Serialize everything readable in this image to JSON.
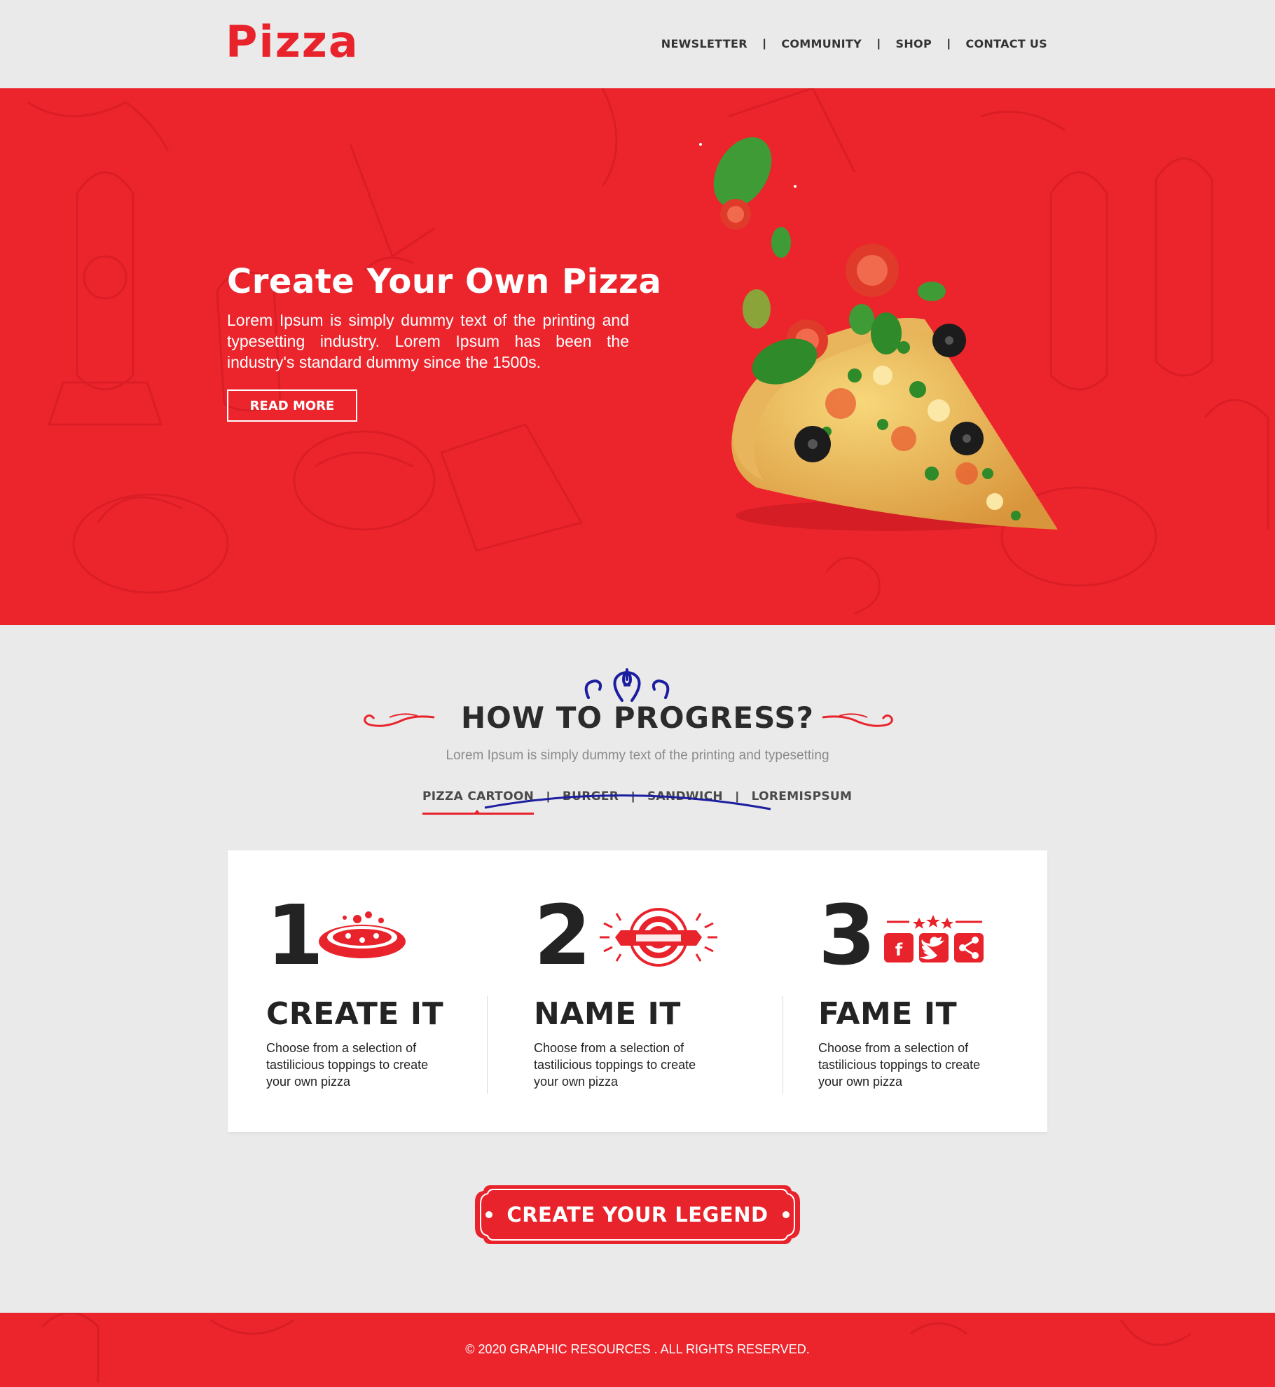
{
  "brand": {
    "logo": "Pizza",
    "accent": "#e8232b",
    "hero_bg": "#ec252d"
  },
  "nav": {
    "items": [
      "NEWSLETTER",
      "COMMUNITY",
      "SHOP",
      "CONTACT US"
    ],
    "separator": "|"
  },
  "hero": {
    "title": "Create Your Own Pizza",
    "text": "Lorem Ipsum is simply dummy text of the printing and typesetting industry. Lorem Ipsum has been the industry's standard dummy since the 1500s.",
    "button": "READ MORE",
    "image": "pizza-slice-with-toppings"
  },
  "section": {
    "title": "HOW TO PROGRESS?",
    "subtitle": "Lorem Ipsum is simply dummy text of the printing and typesetting",
    "tabs": [
      "PIZZA CARTOON",
      "BURGER",
      "SANDWICH",
      "LOREMISPSUM"
    ],
    "active_tab": "PIZZA CARTOON"
  },
  "steps": [
    {
      "number": "1",
      "title": "CREATE IT",
      "text": "Choose from a selection of tastilicious toppings to create your own pizza",
      "icon": "pizza-icon"
    },
    {
      "number": "2",
      "title": "NAME IT",
      "text": "Choose from a selection of tastilicious toppings to create your own pizza",
      "icon": "badge-ribbon-icon"
    },
    {
      "number": "3",
      "title": "FAME IT",
      "text": "Choose from a selection of tastilicious toppings to create your own pizza",
      "icon": "social-share-icon"
    }
  ],
  "cta": {
    "label": "CREATE YOUR LEGEND"
  },
  "footer": {
    "text": "© 2020 GRAPHIC RESOURCES . ALL RIGHTS RESERVED."
  }
}
